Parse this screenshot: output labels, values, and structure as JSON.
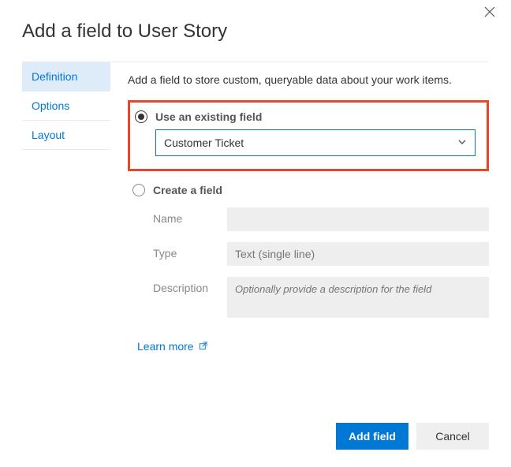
{
  "dialog": {
    "title": "Add a field to User Story"
  },
  "sidebar": {
    "items": [
      {
        "label": "Definition"
      },
      {
        "label": "Options"
      },
      {
        "label": "Layout"
      }
    ]
  },
  "main": {
    "intro": "Add a field to store custom, queryable data about your work items.",
    "existing": {
      "radio_label": "Use an existing field",
      "selected_value": "Customer Ticket"
    },
    "create": {
      "radio_label": "Create a field",
      "name_label": "Name",
      "name_value": "",
      "type_label": "Type",
      "type_value": "Text (single line)",
      "desc_label": "Description",
      "desc_placeholder": "Optionally provide a description for the field"
    },
    "learn_more": "Learn more"
  },
  "footer": {
    "primary": "Add field",
    "secondary": "Cancel"
  }
}
